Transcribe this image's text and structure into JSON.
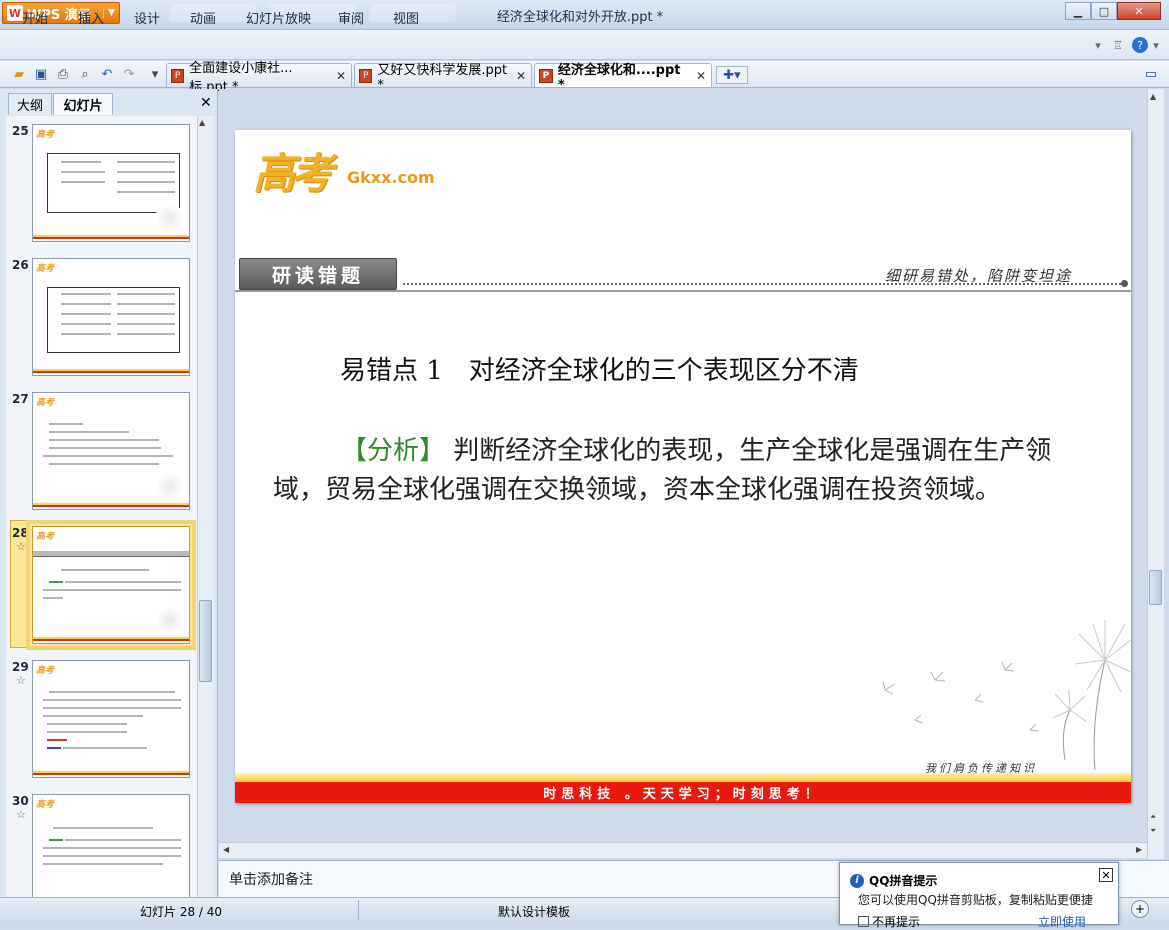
{
  "app": {
    "name": "WPS 演示",
    "window_title": "经济全球化和对外开放.ppt *"
  },
  "menu": [
    "开始",
    "插入",
    "设计",
    "动画",
    "幻灯片放映",
    "审阅",
    "视图"
  ],
  "doc_tabs": [
    {
      "label": "全面建设小康社...标.ppt *",
      "active": false
    },
    {
      "label": "又好又快科学发展.ppt *",
      "active": false
    },
    {
      "label": "经济全球化和....ppt *",
      "active": true
    }
  ],
  "left_pane": {
    "tabs": [
      "大纲",
      "幻灯片"
    ],
    "slide_numbers": [
      "25",
      "26",
      "27",
      "28",
      "29",
      "30"
    ],
    "selected_slide": "28",
    "star_glyph": "☆"
  },
  "slide": {
    "logo_kanji": "高考",
    "logo_site": "Gkxx.com",
    "header_tag": "研读错题",
    "header_motto": "细研易错处，陷阱变坦途",
    "heading": "易错点 1　对经济全球化的三个表现区分不清",
    "analysis_label": "【分析】",
    "analysis_text": "判断经济全球化的表现，生产全球化是强调在生产领域，贸易全球化强调在交换领域，资本全球化强调在投资领域。",
    "footer_signature": "我们肩负传递知识",
    "footer_banner": "时思科技 。天天学习；时刻思考！"
  },
  "notes_placeholder": "单击添加备注",
  "status": {
    "slide_counter": "幻灯片 28 / 40",
    "template": "默认设计模板"
  },
  "qq_popup": {
    "title": "QQ拼音提示",
    "message": "您可以使用QQ拼音剪贴板，复制粘贴更便捷",
    "checkbox_label": "不再提示",
    "link": "立即使用"
  },
  "colors": {
    "accent_orange": "#e07a10",
    "slide_red": "#e8190e",
    "analysis_green": "#2d8a2d"
  }
}
